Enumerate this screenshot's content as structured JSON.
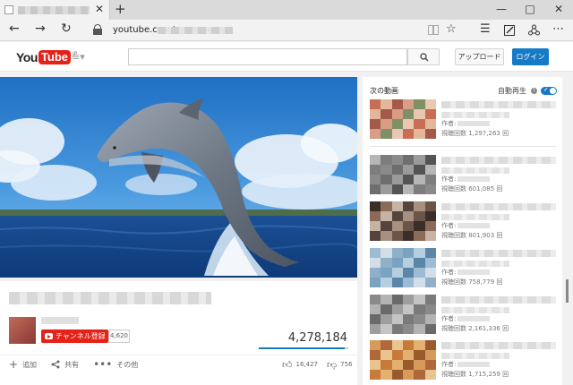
{
  "browser": {
    "new_tab_glyph": "+",
    "url": "youtube.com/",
    "tab_close_glyph": "✕"
  },
  "header": {
    "logo_you": "You",
    "logo_tube": "Tube",
    "logo_region": "JP",
    "upload_label": "アップロード",
    "login_label": "ログイン"
  },
  "video": {
    "subscribe_label": "チャンネル登録",
    "subscriber_count": "4,620",
    "view_count": "4,278,184",
    "like_ratio": 0.956,
    "add_label": "追加",
    "share_label": "共有",
    "more_label": "その他",
    "likes": "16,427",
    "dislikes": "756"
  },
  "sidebar": {
    "heading": "次の動画",
    "autoplay_label": "自動再生",
    "author_prefix": "作者:",
    "items": [
      {
        "views": "視聴回数 1,297,263 回",
        "palette": [
          "#c96e54",
          "#e3b79a",
          "#a45a4a",
          "#d89d84",
          "#7f8f66",
          "#e9c7b0"
        ]
      },
      {
        "views": "視聴回数 601,085 回",
        "palette": [
          "#6e6e6e",
          "#9b9b9b",
          "#545454",
          "#b6b6b6",
          "#7d7d7d",
          "#8a8a8a"
        ]
      },
      {
        "views": "視聴回数 801,903 回",
        "palette": [
          "#3a2e28",
          "#8b6a58",
          "#c6b3a4",
          "#54443b",
          "#a7907f",
          "#6b5548"
        ]
      },
      {
        "views": "視聴回数 758,779 回",
        "palette": [
          "#7aa3c2",
          "#b6cfe0",
          "#5b86a8",
          "#9dbbd2",
          "#d2dfe8",
          "#8fb0c8"
        ]
      },
      {
        "views": "視聴回数 2,161,336 回",
        "palette": [
          "#8a8a8a",
          "#b3b3b3",
          "#6a6a6a",
          "#9e9e9e",
          "#c4c4c4",
          "#7a7a7a"
        ]
      },
      {
        "views": "視聴回数 1,715,259 回",
        "palette": [
          "#c77a3a",
          "#e2b16f",
          "#9a5a2e",
          "#d69a5a",
          "#b0683a",
          "#e8c48e"
        ]
      }
    ]
  }
}
